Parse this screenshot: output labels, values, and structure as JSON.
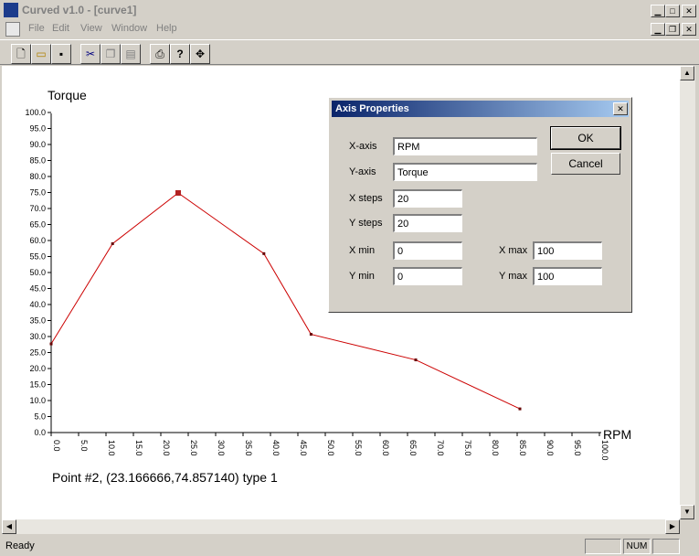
{
  "window": {
    "title": "Curved v1.0 - [curve1]"
  },
  "menu": [
    "File",
    "Edit",
    "View",
    "Window",
    "Help"
  ],
  "status": {
    "text": "Ready",
    "num": "NUM"
  },
  "chart_data": {
    "type": "line",
    "xlabel": "RPM",
    "ylabel": "Torque",
    "xlim": [
      0,
      100
    ],
    "ylim": [
      0,
      100
    ],
    "x_ticks": [
      "0.0",
      "5.0",
      "10.0",
      "15.0",
      "20.0",
      "25.0",
      "30.0",
      "35.0",
      "40.0",
      "45.0",
      "50.0",
      "55.0",
      "60.0",
      "65.0",
      "70.0",
      "75.0",
      "80.0",
      "85.0",
      "90.0",
      "95.0",
      "100.0"
    ],
    "y_ticks": [
      "0.0",
      "5.0",
      "10.0",
      "15.0",
      "20.0",
      "25.0",
      "30.0",
      "35.0",
      "40.0",
      "45.0",
      "50.0",
      "55.0",
      "60.0",
      "65.0",
      "70.0",
      "75.0",
      "80.0",
      "85.0",
      "90.0",
      "95.0",
      "100.0"
    ],
    "points": [
      {
        "x": 0.0,
        "y": 27.7
      },
      {
        "x": 11.2,
        "y": 59.0
      },
      {
        "x": 23.166666,
        "y": 74.85714
      },
      {
        "x": 38.8,
        "y": 55.9
      },
      {
        "x": 47.4,
        "y": 30.7
      },
      {
        "x": 66.5,
        "y": 22.7
      },
      {
        "x": 85.5,
        "y": 7.4
      }
    ],
    "selected_index": 2,
    "line_color": "#cc0000",
    "selected_color": "#b22222"
  },
  "point_info": "Point #2, (23.166666,74.857140) type 1",
  "dialog": {
    "title": "Axis Properties",
    "xaxis_label": "X-axis",
    "xaxis_value": "RPM",
    "yaxis_label": "Y-axis",
    "yaxis_value": "Torque",
    "xsteps_label": "X steps",
    "xsteps_value": "20",
    "ysteps_label": "Y steps",
    "ysteps_value": "20",
    "xmin_label": "X min",
    "xmin_value": "0",
    "xmax_label": "X max",
    "xmax_value": "100",
    "ymin_label": "Y min",
    "ymin_value": "0",
    "ymax_label": "Y max",
    "ymax_value": "100",
    "ok": "OK",
    "cancel": "Cancel"
  }
}
